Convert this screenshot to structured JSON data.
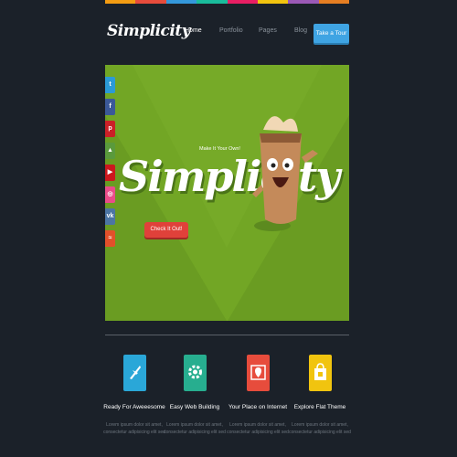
{
  "color_bar": [
    "#f39c12",
    "#e74c3c",
    "#3498db",
    "#1abc9c",
    "#e91e63",
    "#f1c40f",
    "#9b59b6",
    "#e67e22"
  ],
  "header": {
    "logo": "Simplicity",
    "nav": [
      "Home",
      "Portfolio",
      "Pages",
      "Blog"
    ],
    "cta": "Take a Tour"
  },
  "hero": {
    "tagline": "Make It Your Own!",
    "title": "Simplicity",
    "button": "Check It Out!",
    "bg_color": "#72a625"
  },
  "social": [
    {
      "icon": "twitter-icon",
      "glyph": "t",
      "color": "#2b9ad6"
    },
    {
      "icon": "facebook-icon",
      "glyph": "f",
      "color": "#3b5998"
    },
    {
      "icon": "pinterest-icon",
      "glyph": "p",
      "color": "#cb2027"
    },
    {
      "icon": "android-icon",
      "glyph": "▲",
      "color": "#5a9a3c"
    },
    {
      "icon": "youtube-icon",
      "glyph": "▶",
      "color": "#cc181e"
    },
    {
      "icon": "dribbble-icon",
      "glyph": "◎",
      "color": "#ea4c89"
    },
    {
      "icon": "vk-icon",
      "glyph": "vk",
      "color": "#4c75a3"
    },
    {
      "icon": "rss-icon",
      "glyph": "≈",
      "color": "#e2502a"
    }
  ],
  "features": [
    {
      "title": "Ready For Aweeesome",
      "desc": [
        "Lorem ipsum dolor sit amet,",
        "consectetur adipisicing elit sed"
      ],
      "color": "#2aa7d8",
      "icon": "plane-icon"
    },
    {
      "title": "Easy Web Building",
      "desc": [
        "Lorem ipsum dolor sit amet,",
        "consectetur adipisicing elit sed"
      ],
      "color": "#27ae8f",
      "icon": "gear-icon"
    },
    {
      "title": "Your Place on Internet",
      "desc": [
        "Lorem ipsum dolor sit amet,",
        "consectetur adipisicing elit sed"
      ],
      "color": "#e74c3c",
      "icon": "map-pin-icon"
    },
    {
      "title": "Explore Flat Theme",
      "desc": [
        "Lorem ipsum dolor sit amet,",
        "consectetur adipisicing elit sed"
      ],
      "color": "#f1c40f",
      "icon": "shopping-bag-icon"
    }
  ]
}
